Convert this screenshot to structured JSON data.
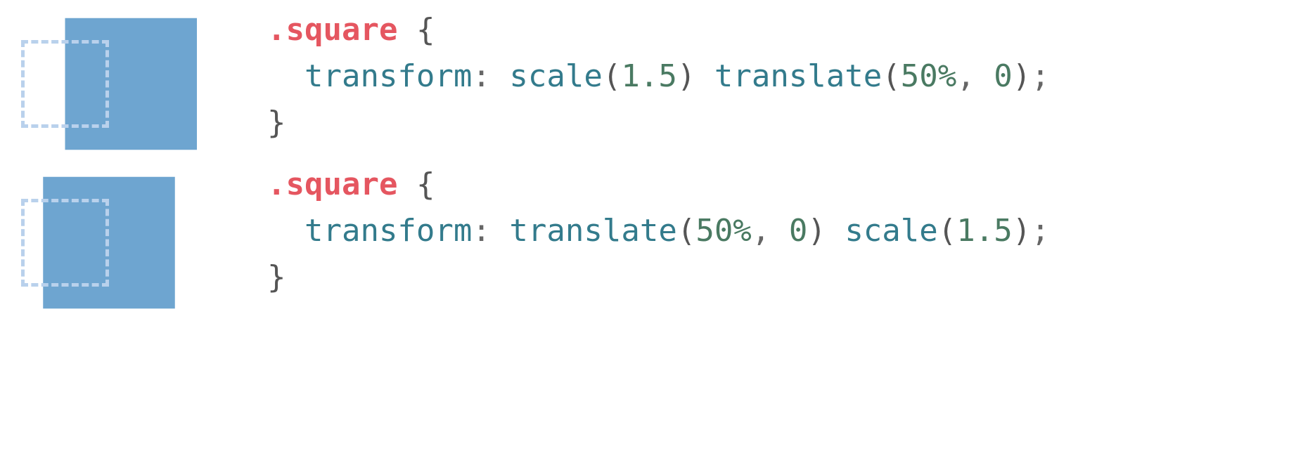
{
  "examples": [
    {
      "selector": ".square",
      "property": "transform",
      "func1": "scale",
      "arg1": "1.5",
      "func2": "translate",
      "arg2a": "50%",
      "arg2b": "0"
    },
    {
      "selector": ".square",
      "property": "transform",
      "func1": "translate",
      "arg1a": "50%",
      "arg1b": "0",
      "func2": "scale",
      "arg2": "1.5"
    }
  ],
  "braces": {
    "open": "{",
    "close": "}"
  },
  "punct": {
    "colon": ":",
    "semi": ";",
    "comma": ",",
    "lparen": "(",
    "rparen": ")",
    "space": " "
  }
}
